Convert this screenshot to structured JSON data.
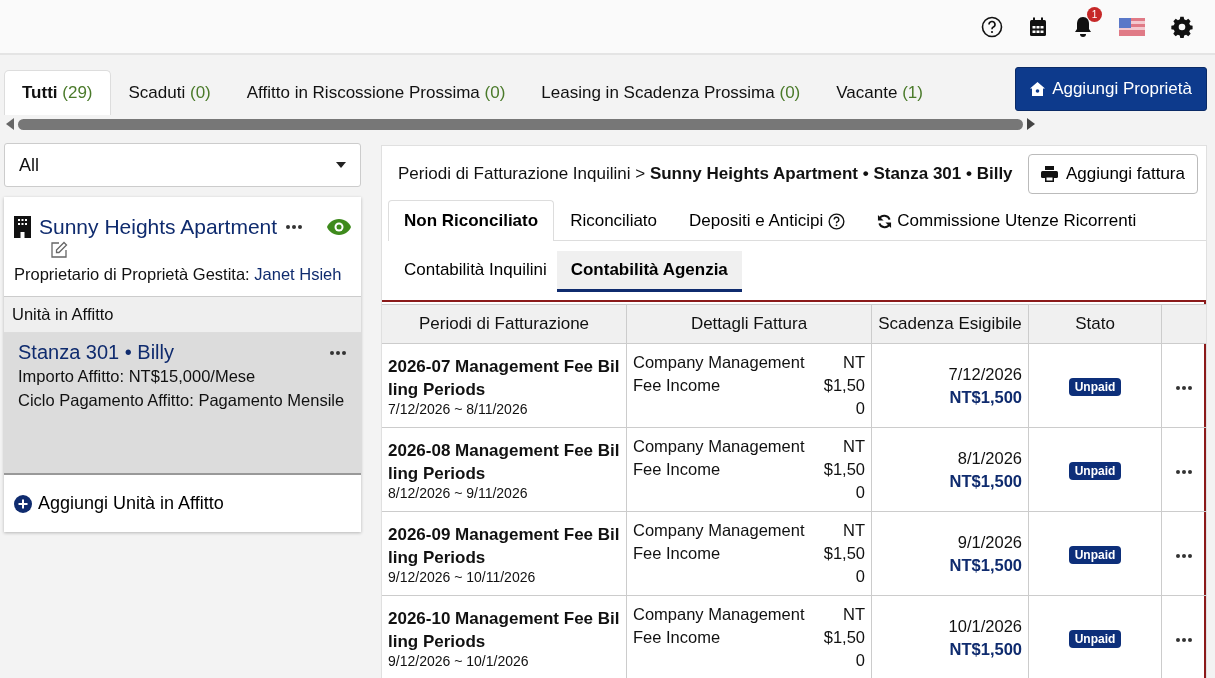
{
  "header": {
    "notification_count": "1"
  },
  "filter_tabs": [
    {
      "label": "Tutti",
      "count": "(29)",
      "selected": true
    },
    {
      "label": "Scaduti",
      "count": "(0)",
      "selected": false
    },
    {
      "label": "Affitto in Riscossione Prossima",
      "count": "(0)",
      "selected": false
    },
    {
      "label": "Leasing in Scadenza Prossima",
      "count": "(0)",
      "selected": false
    },
    {
      "label": "Vacante",
      "count": "(1)",
      "selected": false
    }
  ],
  "add_property_button": "Aggiungi Proprietà",
  "sidebar": {
    "dropdown": "All",
    "property": {
      "name": "Sunny Heights Apartment",
      "owner_label": "Proprietario di Proprietà Gestita:",
      "owner": "Janet Hsieh"
    },
    "units_heading": "Unità in Affitto",
    "units": [
      {
        "title": "Stanza 301 • Billy",
        "rent": "Importo Affitto: NT$15,000/Mese",
        "cycle": "Ciclo Pagamento Affitto: Pagamento Mensile",
        "selected": true
      }
    ],
    "add_unit": "Aggiungi Unità in Affitto"
  },
  "main": {
    "breadcrumb": {
      "parent": "Periodi di Fatturazione Inquilini",
      "separator": ">",
      "current": "Sunny Heights Apartment • Stanza 301 • Billy"
    },
    "add_invoice_button": "Aggiungi fattura",
    "tabs": [
      {
        "label": "Non Riconciliato",
        "kind": "plain",
        "selected": true
      },
      {
        "label": "Riconciliato",
        "kind": "plain",
        "selected": false
      },
      {
        "label": "Depositi e Anticipi",
        "kind": "help",
        "selected": false
      },
      {
        "label": "Commissione Utenze Ricorrenti",
        "kind": "refresh",
        "selected": false
      }
    ],
    "subtabs": [
      {
        "label": "Contabilità Inquilini",
        "selected": false
      },
      {
        "label": "Contabilità Agenzia",
        "selected": true
      }
    ],
    "table": {
      "columns": [
        "Periodi di Fatturazione",
        "Dettagli Fattura",
        "Scadenza Esigibile",
        "Stato"
      ],
      "rows": [
        {
          "period": "2026-07 Management Fee Billing Periods",
          "range": "7/12/2026 ~ 8/11/2026",
          "detail": "Company Management Fee Income",
          "amount": "NT$1,500",
          "due_date": "7/12/2026",
          "due_amount": "NT$1,500",
          "status": "Unpaid"
        },
        {
          "period": "2026-08 Management Fee Billing Periods",
          "range": "8/12/2026 ~ 9/11/2026",
          "detail": "Company Management Fee Income",
          "amount": "NT$1,500",
          "due_date": "8/1/2026",
          "due_amount": "NT$1,500",
          "status": "Unpaid"
        },
        {
          "period": "2026-09 Management Fee Billing Periods",
          "range": "9/12/2026 ~ 10/11/2026",
          "detail": "Company Management Fee Income",
          "amount": "NT$1,500",
          "due_date": "9/1/2026",
          "due_amount": "NT$1,500",
          "status": "Unpaid"
        },
        {
          "period": "2026-10 Management Fee Billing Periods",
          "range": "9/12/2026 ~ 10/1/2026",
          "detail": "Company Management Fee Income",
          "amount": "NT$1,500",
          "due_date": "10/1/2026",
          "due_amount": "NT$1,500",
          "status": "Unpaid"
        }
      ]
    }
  }
}
